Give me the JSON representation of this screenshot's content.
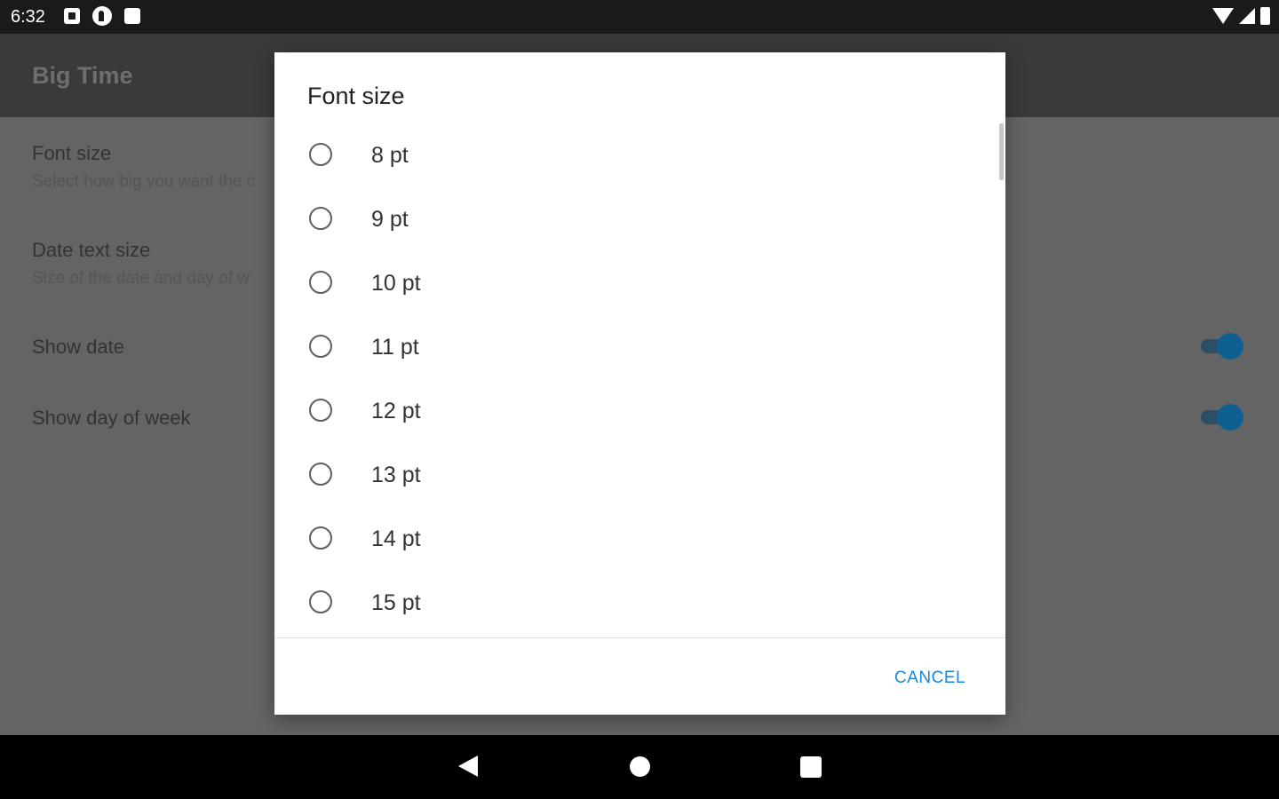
{
  "status_bar": {
    "time": "6:32",
    "left_icons": [
      "notification-a-icon",
      "notification-p-icon",
      "sd-card-icon"
    ],
    "right_icons": [
      "wifi-icon",
      "cell-signal-icon",
      "battery-icon"
    ]
  },
  "app": {
    "title": "Big Time",
    "preferences": [
      {
        "title": "Font size",
        "summary": "Select how big you want the c"
      },
      {
        "title": "Date text size",
        "summary": "Size of the date and day of w"
      },
      {
        "title": "Show date",
        "toggle": true
      },
      {
        "title": "Show day of week",
        "toggle": true
      }
    ]
  },
  "dialog": {
    "title": "Font size",
    "options": [
      "8 pt",
      "9 pt",
      "10 pt",
      "11 pt",
      "12 pt",
      "13 pt",
      "14 pt",
      "15 pt"
    ],
    "cancel_label": "CANCEL"
  },
  "colors": {
    "accent": "#1a88d8",
    "toggle_thumb": "#0f5f92",
    "scrim": "#646464"
  },
  "nav_bar": {
    "icons": [
      "back-icon",
      "home-icon",
      "recents-icon"
    ]
  }
}
